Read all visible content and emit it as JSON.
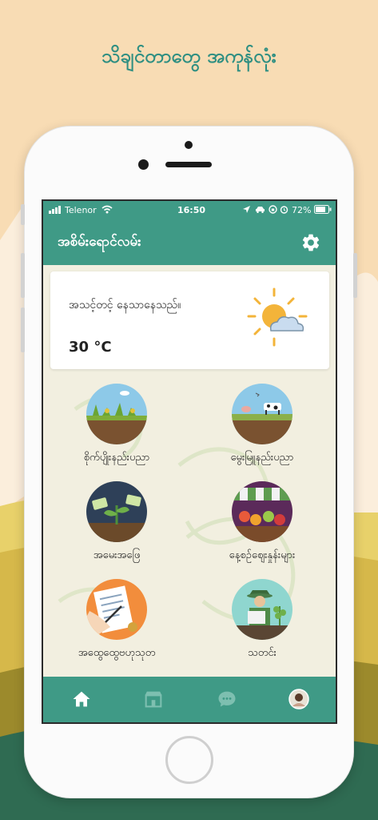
{
  "headline": "သိချင်တာတွေ အကုန်လုံး",
  "status_bar": {
    "carrier": "Telenor",
    "time": "16:50",
    "battery": "72%"
  },
  "app_bar": {
    "title": "အစိမ်းရောင်လမ်း",
    "settings_icon": "gear-icon"
  },
  "weather": {
    "description": "အသင့်တင့် နေသာနေသည်။",
    "temperature": "30 °C",
    "icon": "partly-sunny-icon"
  },
  "menu": [
    {
      "label": "စိုက်ပျိုးနည်းပညာ",
      "icon": "crops-field"
    },
    {
      "label": "မွေးမြူနည်းပညာ",
      "icon": "livestock-farm"
    },
    {
      "label": "အမေးအဖြေ",
      "icon": "plant-qa"
    },
    {
      "label": "နေ့စဉ်ဈေးနှုန်းများ",
      "icon": "market-stall"
    },
    {
      "label": "အထွေထွေဗဟုသုတ",
      "icon": "signing-document"
    },
    {
      "label": "သတင်း",
      "icon": "farmer-reading-news"
    }
  ],
  "bottom_nav": [
    {
      "icon": "home-icon",
      "active": true
    },
    {
      "icon": "store-icon",
      "active": false
    },
    {
      "icon": "chat-icon",
      "active": false
    },
    {
      "icon": "profile-avatar",
      "active": false
    }
  ],
  "colors": {
    "brand": "#3f9a86",
    "headline": "#2f8f82",
    "background": "#f8dcb4",
    "screen_bg": "#f2efe0"
  }
}
